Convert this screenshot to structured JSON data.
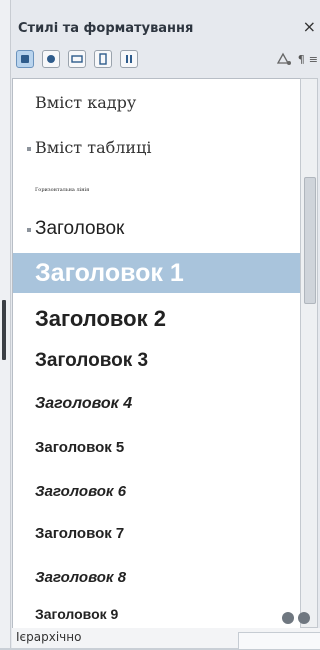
{
  "panel": {
    "title": "Стилі та форматування",
    "close_glyph": "×",
    "toolbar": [
      {
        "name": "paragraph-styles-icon",
        "selected": true
      },
      {
        "name": "character-styles-icon",
        "selected": false
      },
      {
        "name": "frame-styles-icon",
        "selected": false
      },
      {
        "name": "page-styles-icon",
        "selected": false
      },
      {
        "name": "list-styles-icon",
        "selected": false
      }
    ],
    "right_controls": {
      "fill_format_icon": "fill-format-icon",
      "new_style_label": "¶",
      "menu_label": "≡"
    }
  },
  "styles_list": {
    "selected_index": 4,
    "items": [
      {
        "label": "Вміст кадру",
        "font": "serif",
        "size": 16,
        "weight": "normal",
        "italic": false,
        "bullet": false
      },
      {
        "label": "Вміст таблиці",
        "font": "serif",
        "size": 16,
        "weight": "normal",
        "italic": false,
        "bullet": true
      },
      {
        "label": "Горизонтальна лінія",
        "font": "serif",
        "size": 5,
        "weight": "normal",
        "italic": false,
        "bullet": false
      },
      {
        "label": "Заголовок",
        "font": "sans",
        "size": 19,
        "weight": "normal",
        "italic": false,
        "bullet": true
      },
      {
        "label": "Заголовок 1",
        "font": "sans",
        "size": 25,
        "weight": "bold",
        "italic": false,
        "bullet": false
      },
      {
        "label": "Заголовок 2",
        "font": "sans",
        "size": 22,
        "weight": "bold",
        "italic": false,
        "bullet": false
      },
      {
        "label": "Заголовок 3",
        "font": "sans",
        "size": 19,
        "weight": "bold",
        "italic": false,
        "bullet": false
      },
      {
        "label": "Заголовок 4",
        "font": "sans",
        "size": 16,
        "weight": "bold",
        "italic": true,
        "bullet": false
      },
      {
        "label": "Заголовок 5",
        "font": "sans",
        "size": 15,
        "weight": "bold",
        "italic": false,
        "bullet": false
      },
      {
        "label": "Заголовок 6",
        "font": "sans",
        "size": 15,
        "weight": "bold",
        "italic": true,
        "bullet": false
      },
      {
        "label": "Заголовок 7",
        "font": "sans",
        "size": 15,
        "weight": "bold",
        "italic": false,
        "bullet": false
      },
      {
        "label": "Заголовок 8",
        "font": "sans",
        "size": 15,
        "weight": "bold",
        "italic": true,
        "bullet": false
      },
      {
        "label": "Заголовок 9",
        "font": "sans",
        "size": 14,
        "weight": "bold",
        "italic": false,
        "bullet": false
      }
    ]
  },
  "status": {
    "filter_label": "Ієрархічно"
  },
  "colors": {
    "selection": "#a9c4dc",
    "selection_text": "#ffffff"
  }
}
